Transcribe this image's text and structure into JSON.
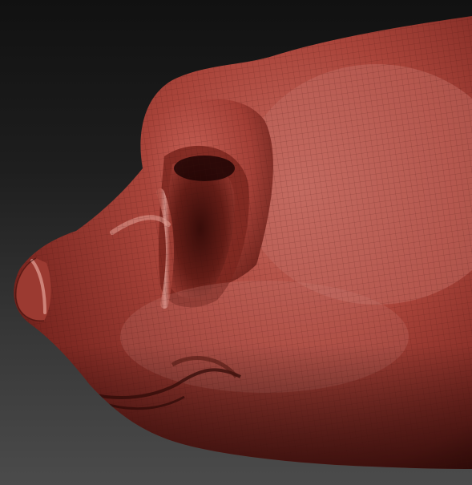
{
  "viewport": {
    "background_top": "#111111",
    "background_bottom": "#4b4b4b"
  },
  "model": {
    "material_color": "#a9443a",
    "highlight_color": "#d98a7f",
    "shadow_color": "#3a0d0a",
    "wireframe": true
  }
}
